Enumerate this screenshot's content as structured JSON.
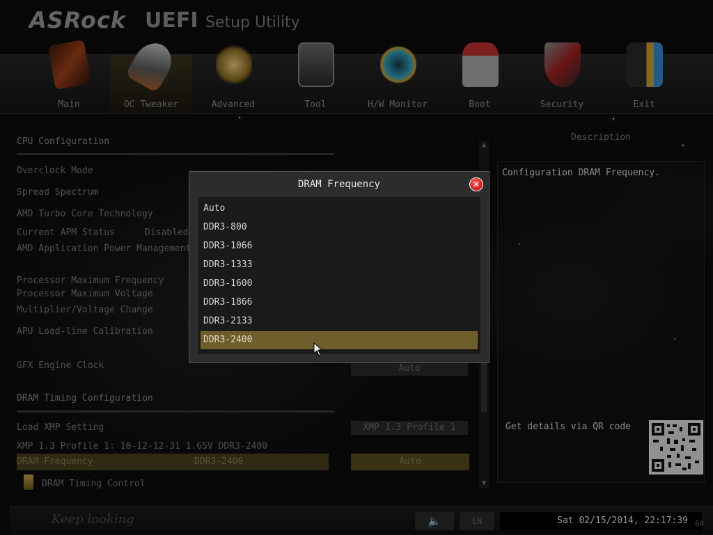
{
  "header": {
    "logo": "ASRock",
    "title_main": "UEFI",
    "title_sub": "Setup Utility"
  },
  "nav": {
    "active_index": 1,
    "items": [
      {
        "label": "Main",
        "icon": "main-icon",
        "color": "#7a3a1a"
      },
      {
        "label": "OC Tweaker",
        "icon": "rocket-icon",
        "color": "#6a6a6a"
      },
      {
        "label": "Advanced",
        "icon": "star-icon",
        "color": "#b8903a"
      },
      {
        "label": "Tool",
        "icon": "toolbox-icon",
        "color": "#4a4a4a"
      },
      {
        "label": "H/W Monitor",
        "icon": "radar-icon",
        "color": "#2a8aa0"
      },
      {
        "label": "Boot",
        "icon": "joystick-icon",
        "color": "#a03030"
      },
      {
        "label": "Security",
        "icon": "shield-icon",
        "color": "#8a2a2a"
      },
      {
        "label": "Exit",
        "icon": "exit-door-icon",
        "color": "#c9a030"
      }
    ]
  },
  "settings": {
    "cpu_config": "CPU Configuration",
    "overclock_mode": "Overclock Mode",
    "spread_spectrum": "Spread Spectrum",
    "amd_turbo": "AMD Turbo Core Technology",
    "current_apm_label": "Current APM Status",
    "current_apm_value": "Disabled",
    "amd_app_power": "AMD Application Power Management",
    "proc_max_freq": "Processor Maximum Frequency",
    "proc_max_volt": "Processor Maximum Voltage",
    "mult_volt": "Multiplier/Voltage Change",
    "apu_llc": "APU Load-line Calibration",
    "gfx_clock": "GFX Engine Clock",
    "gfx_value": "Auto",
    "dram_timing_config": "DRAM Timing Configuration",
    "load_xmp": "Load XMP Setting",
    "load_xmp_value": "XMP 1.3 Profile 1",
    "xmp_profile": "XMP 1.3 Profile 1: 10-12-12-31 1.65V DDR3-2400",
    "dram_freq_label": "DRAM Frequency",
    "dram_freq_current": "DDR3-2400",
    "dram_freq_value": "Auto",
    "dram_timing_control": "DRAM Timing Control"
  },
  "description": {
    "title": "Description",
    "text": "Configuration DRAM Frequency.",
    "qr_text": "Get details via QR code"
  },
  "footer": {
    "tagline": "Keep looking",
    "lang": "EN",
    "datetime": "Sat 02/15/2014, 22:17:39",
    "corner": "64"
  },
  "modal": {
    "title": "DRAM Frequency",
    "selected_index": 7,
    "options": [
      "Auto",
      "DDR3-800",
      "DDR3-1066",
      "DDR3-1333",
      "DDR3-1600",
      "DDR3-1866",
      "DDR3-2133",
      "DDR3-2400"
    ]
  },
  "colors": {
    "accent_selected": "#6e5e2c",
    "close_button": "#d01010"
  }
}
